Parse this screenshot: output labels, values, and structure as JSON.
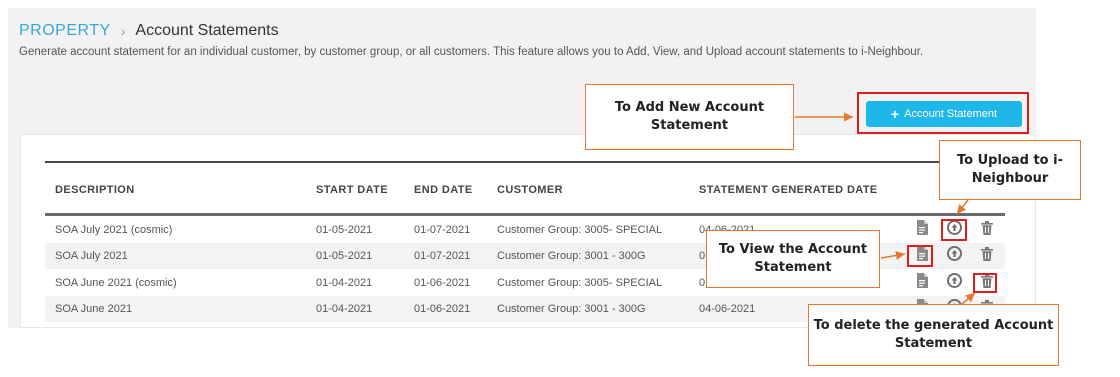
{
  "breadcrumb": {
    "root": "PROPERTY",
    "separator": "›",
    "current": "Account Statements"
  },
  "description": "Generate account statement for an individual customer, by customer group, or all customers. This feature allows you to Add, View, and Upload account statements to i-Neighbour.",
  "add_button": {
    "label": "Account Statement",
    "icon": "plus-icon"
  },
  "table": {
    "headers": {
      "description": "DESCRIPTION",
      "start_date": "START DATE",
      "end_date": "END DATE",
      "customer": "CUSTOMER",
      "generated": "STATEMENT GENERATED DATE"
    },
    "rows": [
      {
        "description": "SOA July 2021 (cosmic)",
        "start_date": "01-05-2021",
        "end_date": "01-07-2021",
        "customer": "Customer Group: 3005- SPECIAL",
        "generated": "04-06-2021"
      },
      {
        "description": "SOA July 2021",
        "start_date": "01-05-2021",
        "end_date": "01-07-2021",
        "customer": "Customer Group: 3001 - 300G",
        "generated": "0"
      },
      {
        "description": "SOA June 2021 (cosmic)",
        "start_date": "01-04-2021",
        "end_date": "01-06-2021",
        "customer": "Customer Group: 3005- SPECIAL",
        "generated": "0"
      },
      {
        "description": "SOA June 2021",
        "start_date": "01-04-2021",
        "end_date": "01-06-2021",
        "customer": "Customer Group: 3001 - 300G",
        "generated": "04-06-2021"
      }
    ],
    "action_icons": [
      "document-icon",
      "upload-icon",
      "trash-icon"
    ]
  },
  "callouts": {
    "add": "To Add New Account Statement",
    "upload": "To Upload to i-Neighbour",
    "view": "To View the Account Statement",
    "delete": "To delete the generated Account Statement"
  },
  "colors": {
    "accent": "#1fb6e8",
    "link": "#3aa6d8",
    "highlight": "#e11d1d",
    "callout_border": "#e8772e"
  }
}
